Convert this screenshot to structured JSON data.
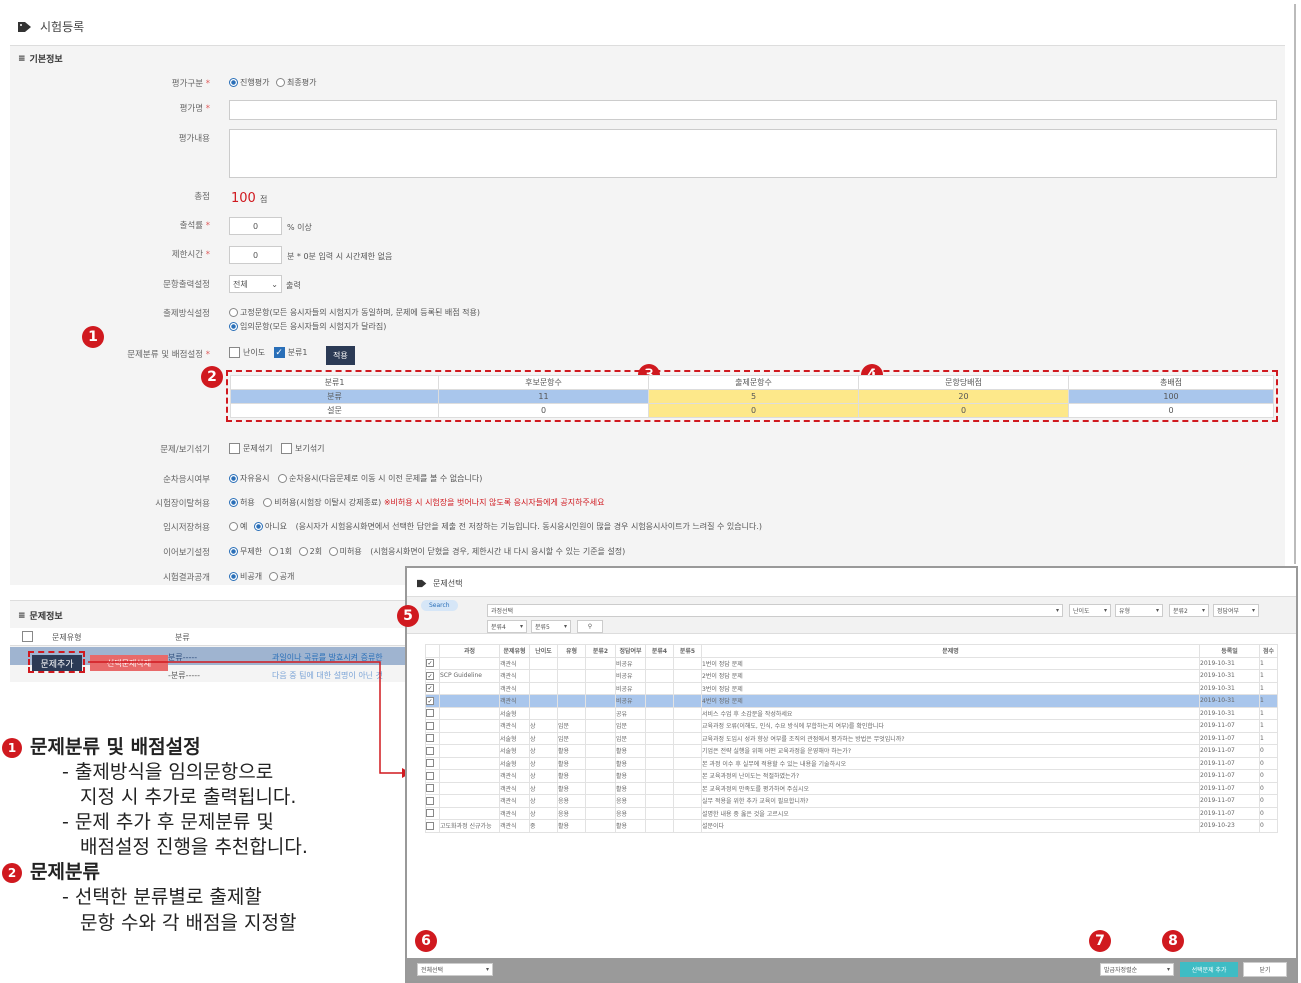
{
  "page_title": "시험등록",
  "basic": {
    "header": "기본정보",
    "eval_type_label": "평가구분",
    "eval_type_opts": [
      "진행평가",
      "최종평가"
    ],
    "eval_name_label": "평가명",
    "eval_content_label": "평가내용",
    "total_label": "총점",
    "total_value": "100",
    "total_unit": "점",
    "attendance_label": "출석률",
    "attendance_value": "0",
    "attendance_suffix": "% 이상",
    "timelimit_label": "제한시간",
    "timelimit_value": "0",
    "timelimit_suffix": "분 * 0분 입력 시 시간제한 없음",
    "print_label": "문항출력설정",
    "print_value": "전체",
    "print_suffix": "출력",
    "method_label": "출제방식설정",
    "method_opt1": "고정문항(모든 응시자들의 시험지가 동일하며, 문제에 등록된 배점 적용)",
    "method_opt2": "임의문항(모든 응시자들의 시험지가 달라짐)",
    "class_label": "문제분류 및 배점설정",
    "class_chk1": "난이도",
    "class_chk2": "분류1",
    "apply_btn": "적용",
    "shuffle_label": "문제/보기섞기",
    "shuffle_opt1": "문제섞기",
    "shuffle_opt2": "보기섞기",
    "order_label": "순차응시여부",
    "order_opt1": "자유응시",
    "order_opt2": "순차응시(다음문제로 이동 시 이전 문제를 볼 수 없습니다)",
    "leave_label": "시험장이탈허용",
    "leave_opt1": "허용",
    "leave_opt2": "비허용(시험장 이탈시 강제종료)",
    "leave_warn": "※비허용 시 시험장을 벗어나지 않도록 응시자들에게 공지하주세요",
    "tempsave_label": "임시저장허용",
    "tempsave_opt1": "예",
    "tempsave_opt2": "아니요",
    "tempsave_note": "(응시자가 시험응시화면에서 선택한 답안을 제출 전 저장하는 기능입니다. 동시응시인원이 많을 경우 시험응시사이트가 느려질 수 있습니다.)",
    "resume_label": "이어보기설정",
    "resume_opts": [
      "무제한",
      "1회",
      "2회",
      "미허용"
    ],
    "resume_note": "(시험응시화면이 닫혔을 경우, 제한시간 내 다시 응시할 수 있는 기준을 설정)",
    "result_label": "시험결과공개",
    "result_opts": [
      "비공개",
      "공개"
    ]
  },
  "class_table": {
    "headers": [
      "분류1",
      "후보문항수",
      "출제문항수",
      "문항당배점",
      "총배점"
    ],
    "rows": [
      [
        "분류",
        "11",
        "5",
        "20",
        "100"
      ],
      [
        "설문",
        "0",
        "0",
        "0",
        "0"
      ]
    ]
  },
  "question_info": {
    "header": "문제정보",
    "col1": "문제유형",
    "col2": "분류",
    "add_btn": "문제추가",
    "delete_btn": "선택문제삭제",
    "row1_class": "분류-----",
    "row1_text": "과일이나 곡류를 발효시켜 증류한",
    "row2_class": "-분류-----",
    "row2_text": "다음 중 팀에 대한 설명이 아닌 것"
  },
  "modal": {
    "title": "문제선택",
    "search_label": "Search",
    "filters_row1": [
      "과정선택",
      "난이도",
      "유형",
      "분류2",
      "정답여부"
    ],
    "filters_row2": [
      "분류4",
      "분류5"
    ],
    "headers": [
      "",
      "과정",
      "문제유형",
      "난이도",
      "유형",
      "분류2",
      "정답여부",
      "분류4",
      "분류5",
      "문제명",
      "등록일",
      "점수"
    ],
    "rows": [
      {
        "checked": true,
        "c": [
          "",
          "객관식",
          "",
          "",
          "",
          "비공유",
          "",
          "",
          "1번이 정답 문제",
          "2019-10-31",
          "1"
        ],
        "hl": false
      },
      {
        "checked": true,
        "c": [
          "SCP Guideline",
          "객관식",
          "",
          "",
          "",
          "비공유",
          "",
          "",
          "2번이 정답 문제",
          "2019-10-31",
          "1"
        ],
        "hl": false
      },
      {
        "checked": true,
        "c": [
          "",
          "객관식",
          "",
          "",
          "",
          "비공유",
          "",
          "",
          "3번이 정답 문제",
          "2019-10-31",
          "1"
        ],
        "hl": false
      },
      {
        "checked": true,
        "c": [
          "",
          "객관식",
          "",
          "",
          "",
          "비공유",
          "",
          "",
          "4번이 정답 문제",
          "2019-10-31",
          "1"
        ],
        "hl": true
      },
      {
        "checked": false,
        "c": [
          "",
          "서술형",
          "",
          "",
          "",
          "공유",
          "",
          "",
          "서비스 수업 후 소감문을 작성하세요",
          "2019-10-31",
          "1"
        ],
        "hl": false
      },
      {
        "checked": false,
        "c": [
          "",
          "객관식",
          "상",
          "입문",
          "",
          "입문",
          "",
          "",
          "교육과정 오류(이해도, 인식, 수요 방식에 부합하는지 여부)를 확인합니다",
          "2019-11-07",
          "1"
        ],
        "hl": false
      },
      {
        "checked": false,
        "c": [
          "",
          "서술형",
          "상",
          "입문",
          "",
          "입문",
          "",
          "",
          "교육과정 도입시 성과 향상 여부를 조직의 관점에서 평가하는 방법은 무엇입니까?",
          "2019-11-07",
          "1"
        ],
        "hl": false
      },
      {
        "checked": false,
        "c": [
          "",
          "서술형",
          "상",
          "활용",
          "",
          "활용",
          "",
          "",
          "기업은 전략 실행을 위해 어떤 교육과정을 운영해야 하는가?",
          "2019-11-07",
          "0"
        ],
        "hl": false
      },
      {
        "checked": false,
        "c": [
          "",
          "서술형",
          "상",
          "활용",
          "",
          "활용",
          "",
          "",
          "본 과정 이수 후 실무에 적용할 수 있는 내용을 기술하시오",
          "2019-11-07",
          "0"
        ],
        "hl": false
      },
      {
        "checked": false,
        "c": [
          "",
          "객관식",
          "상",
          "활용",
          "",
          "활용",
          "",
          "",
          "본 교육과정의 난이도는 적절하였는가?",
          "2019-11-07",
          "0"
        ],
        "hl": false
      },
      {
        "checked": false,
        "c": [
          "",
          "객관식",
          "상",
          "활용",
          "",
          "활용",
          "",
          "",
          "본 교육과정의 만족도를 평가하여 주십시오",
          "2019-11-07",
          "0"
        ],
        "hl": false
      },
      {
        "checked": false,
        "c": [
          "",
          "객관식",
          "상",
          "응용",
          "",
          "응용",
          "",
          "",
          "실무 적용을 위한 추가 교육이 필요합니까?",
          "2019-11-07",
          "0"
        ],
        "hl": false
      },
      {
        "checked": false,
        "c": [
          "",
          "객관식",
          "상",
          "응용",
          "",
          "응용",
          "",
          "",
          "설명한 내용 중 옳은 것을 고르시오",
          "2019-11-07",
          "0"
        ],
        "hl": false
      },
      {
        "checked": false,
        "c": [
          "고도화과정 신규가능",
          "객관식",
          "중",
          "활용",
          "",
          "활용",
          "",
          "",
          "설문이다",
          "2019-10-23",
          "0"
        ],
        "hl": false
      }
    ],
    "footer_select": "전체선택",
    "footer_select2": "발급자정렬순",
    "add_btn": "선택문제 추가",
    "close_btn": "닫기"
  },
  "badges": [
    "1",
    "2",
    "3",
    "4",
    "5",
    "6",
    "7",
    "8"
  ],
  "notes": {
    "n1_title": "문제분류 및 배점설정",
    "n1_l1": "- 출제방식을 임의문항으로",
    "n1_l2": "지정 시 추가로 출력됩니다.",
    "n1_l3": "- 문제 추가 후 문제분류 및",
    "n1_l4": "배점설정 진행을 추천합니다.",
    "n2_title": "문제분류",
    "n2_l1": "- 선택한 분류별로 출제할",
    "n2_l2": "문항 수와 각 배점을 지정할"
  },
  "colors": {
    "badge": "#d0191f",
    "highlight_row": "#a9c6ec",
    "yellow_cell": "#fde88a",
    "btn_dark": "#2b3a55",
    "btn_teal": "#3fbcc4"
  }
}
